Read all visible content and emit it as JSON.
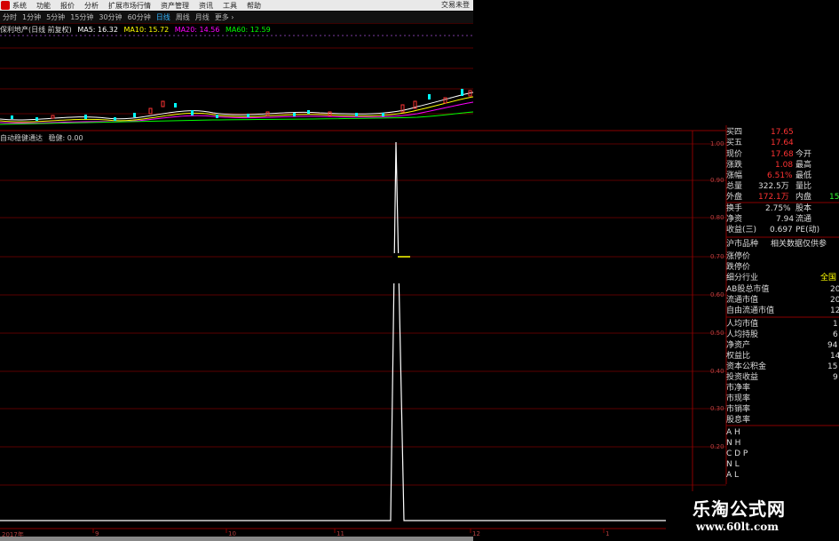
{
  "menu": {
    "items": [
      "系统",
      "功能",
      "报价",
      "分析",
      "扩展市场行情",
      "资产管理",
      "资讯",
      "工具",
      "帮助"
    ],
    "right": "交易未登"
  },
  "periods": {
    "items": [
      "分时",
      "1分钟",
      "5分钟",
      "15分钟",
      "30分钟",
      "60分钟",
      "日线",
      "周线",
      "月线",
      "更多 ›"
    ],
    "active": "日线"
  },
  "ma_legend": {
    "title": "保利地产(日线 前复权)",
    "ma5": "MA5: 16.32",
    "ma10": "MA10: 15.72",
    "ma20": "MA20: 14.56",
    "ma60": "MA60: 12.59",
    "colors": {
      "ma5": "#ffffff",
      "ma10": "#ffff00",
      "ma20": "#ff00ff",
      "ma60": "#00ff00"
    }
  },
  "indicator": {
    "label": "自动稳健通达",
    "value_label": "稳健: 0.00"
  },
  "y_axis": {
    "labels": [
      "1.00",
      "0.90",
      "0.80",
      "0.70",
      "0.60",
      "0.50",
      "0.40",
      "0.30",
      "0.20"
    ]
  },
  "x_axis": {
    "labels": [
      "2017年",
      "9",
      "10",
      "11",
      "12",
      "1"
    ]
  },
  "quote_panel": {
    "buy4_label": "买四",
    "buy4_value": "17.65",
    "buy5_label": "买五",
    "buy5_value": "17.64",
    "price_label": "现价",
    "price_value": "17.68",
    "open_label": "今开",
    "change_label": "涨跌",
    "change_value": "1.08",
    "high_label": "最高",
    "pct_label": "涨幅",
    "pct_value": "6.51%",
    "low_label": "最低",
    "volume_label": "总量",
    "volume_value": "322.5万",
    "ratio_label": "量比",
    "outer_label": "外盘",
    "outer_value": "172.1万",
    "inner_label": "内盘",
    "inner_value": "15",
    "turnover_label": "换手",
    "turnover_value": "2.75%",
    "equity_label": "股本",
    "nav_label": "净资",
    "nav_value": "7.94",
    "float_label": "流通",
    "eps_label": "收益(三)",
    "eps_value": "0.697",
    "pe_label": "PE(动)",
    "category_label": "沪市品种",
    "category_note": "相关数据仅供参",
    "limit_up_label": "涨停价",
    "limit_down_label": "跌停价",
    "industry_label": "细分行业",
    "industry_value": "全国",
    "ab_cap_label": "AB股总市值",
    "ab_cap_value": "20",
    "float_cap_label": "流通市值",
    "float_cap_value": "20",
    "free_cap_label": "自由流通市值",
    "free_cap_value": "12",
    "per_capita_label": "人均市值",
    "per_capita_value": "1",
    "per_hold_label": "人均持股",
    "per_hold_value": "6",
    "net_assets_label": "净资产",
    "net_assets_value": "94",
    "equity_ratio_label": "权益比",
    "equity_ratio_value": "14",
    "capital_reserve_label": "资本公积金",
    "capital_reserve_value": "15",
    "invest_income_label": "投资收益",
    "invest_income_value": "9",
    "pb_label": "市净率",
    "pcf_label": "市现率",
    "ps_label": "市销率",
    "dividend_label": "股息率",
    "ah_label": "A H",
    "nh_label": "N H",
    "cdp_label": "C D P",
    "nl_label": "N L",
    "al_label": "A L"
  },
  "watermark": {
    "title": "乐淘公式网",
    "url": "www.60lt.com"
  }
}
